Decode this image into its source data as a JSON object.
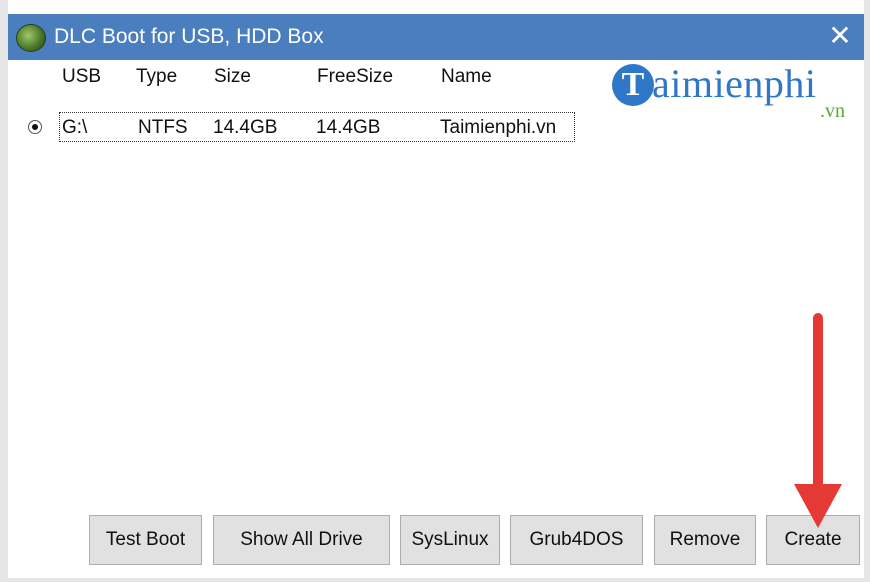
{
  "window": {
    "title": "DLC Boot for USB, HDD Box",
    "close_glyph": "✕",
    "app_icon": "dlc-globe-icon",
    "titlebar_color": "#4a7ebf"
  },
  "table": {
    "columns": [
      "USB",
      "Type",
      "Size",
      "FreeSize",
      "Name"
    ],
    "rows": [
      {
        "selected": true,
        "usb": "G:\\",
        "type": "NTFS",
        "size": "14.4GB",
        "free": "14.4GB",
        "name": "Taimienphi.vn"
      }
    ]
  },
  "watermark": {
    "letter": "T",
    "text": "aimienphi",
    "suffix": ".vn",
    "color": "#2f78c7",
    "suffix_color": "#5aa83a"
  },
  "buttons": {
    "test_boot": "Test Boot",
    "show_all_drive": "Show All Drive",
    "syslinux": "SysLinux",
    "grub4dos": "Grub4DOS",
    "remove": "Remove",
    "create": "Create"
  },
  "annotation": {
    "arrow_color": "#e53935",
    "points_to": "create"
  }
}
